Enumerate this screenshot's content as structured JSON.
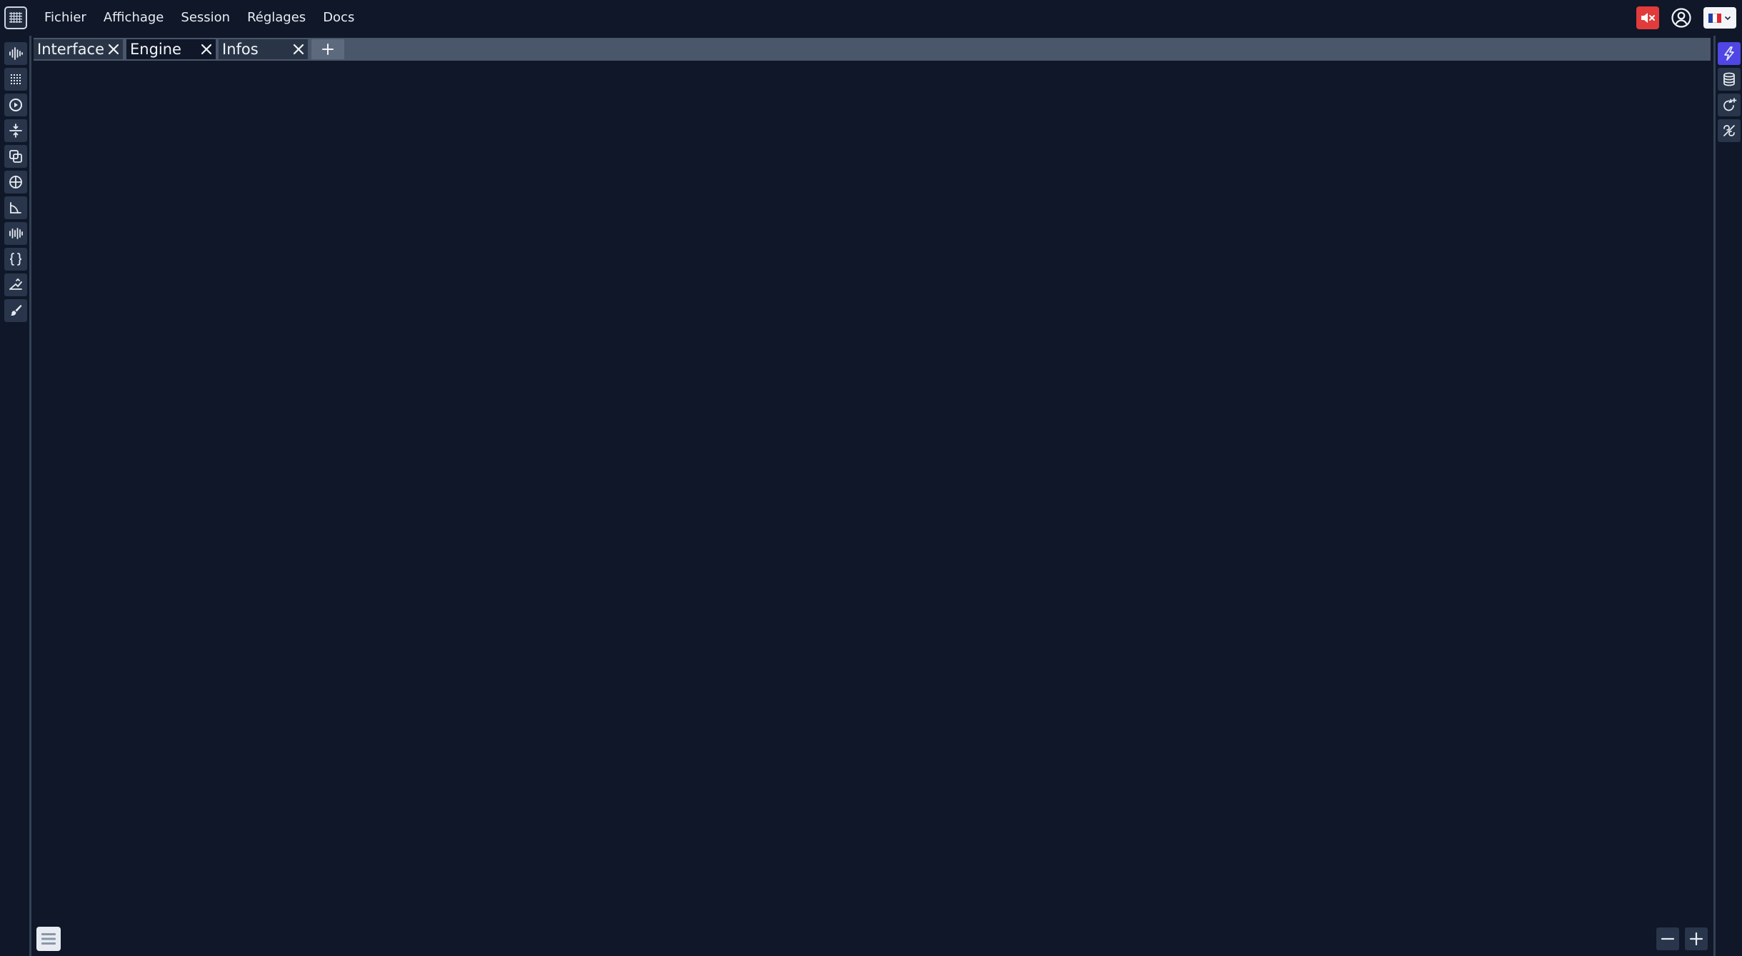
{
  "menu": {
    "items": [
      {
        "label": "Fichier"
      },
      {
        "label": "Affichage"
      },
      {
        "label": "Session"
      },
      {
        "label": "Réglages"
      },
      {
        "label": "Docs"
      }
    ]
  },
  "tabs": [
    {
      "label": "Interface",
      "active": false
    },
    {
      "label": "Engine",
      "active": true
    },
    {
      "label": "Infos",
      "active": false
    }
  ],
  "left_toolbar": {
    "icons": [
      "waveform-icon",
      "grid-icon",
      "play-circle-icon",
      "move-vertical-icon",
      "layers-icon",
      "globe-icon",
      "angle-icon",
      "audio-bars-icon",
      "braces-icon",
      "ramp-icon",
      "brush-icon"
    ]
  },
  "right_toolbar": {
    "icons": [
      "lightning-icon",
      "database-icon",
      "refresh-plus-icon",
      "links-icon"
    ],
    "active_index": 0
  },
  "top_right": {
    "language": "fr",
    "mute_color": "#e23b3b"
  },
  "colors": {
    "background": "#0f1728",
    "accent": "#4f46e5",
    "tab_bar": "#4a5669"
  }
}
